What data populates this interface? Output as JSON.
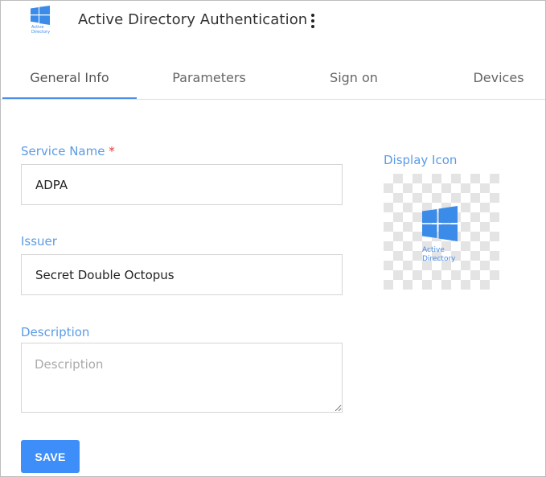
{
  "header": {
    "title": "Active Directory Authentication",
    "logo_text_line1": "Active",
    "logo_text_line2": "Directory",
    "menu_icon": "kebab-menu-icon"
  },
  "tabs": [
    {
      "label": "General Info",
      "active": true
    },
    {
      "label": "Parameters",
      "active": false
    },
    {
      "label": "Sign on",
      "active": false
    },
    {
      "label": "Devices",
      "active": false
    }
  ],
  "form": {
    "service_name": {
      "label": "Service Name",
      "required_mark": "*",
      "value": "ADPA"
    },
    "issuer": {
      "label": "Issuer",
      "value": "Secret Double Octopus"
    },
    "description": {
      "label": "Description",
      "value": "",
      "placeholder": "Description"
    },
    "save_label": "SAVE"
  },
  "display_icon": {
    "label": "Display Icon",
    "logo_text_line1": "Active",
    "logo_text_line2": "Directory"
  },
  "colors": {
    "accent": "#4a8ee8",
    "label": "#5b9be6",
    "button": "#3d8ef8",
    "required": "#e53935"
  }
}
